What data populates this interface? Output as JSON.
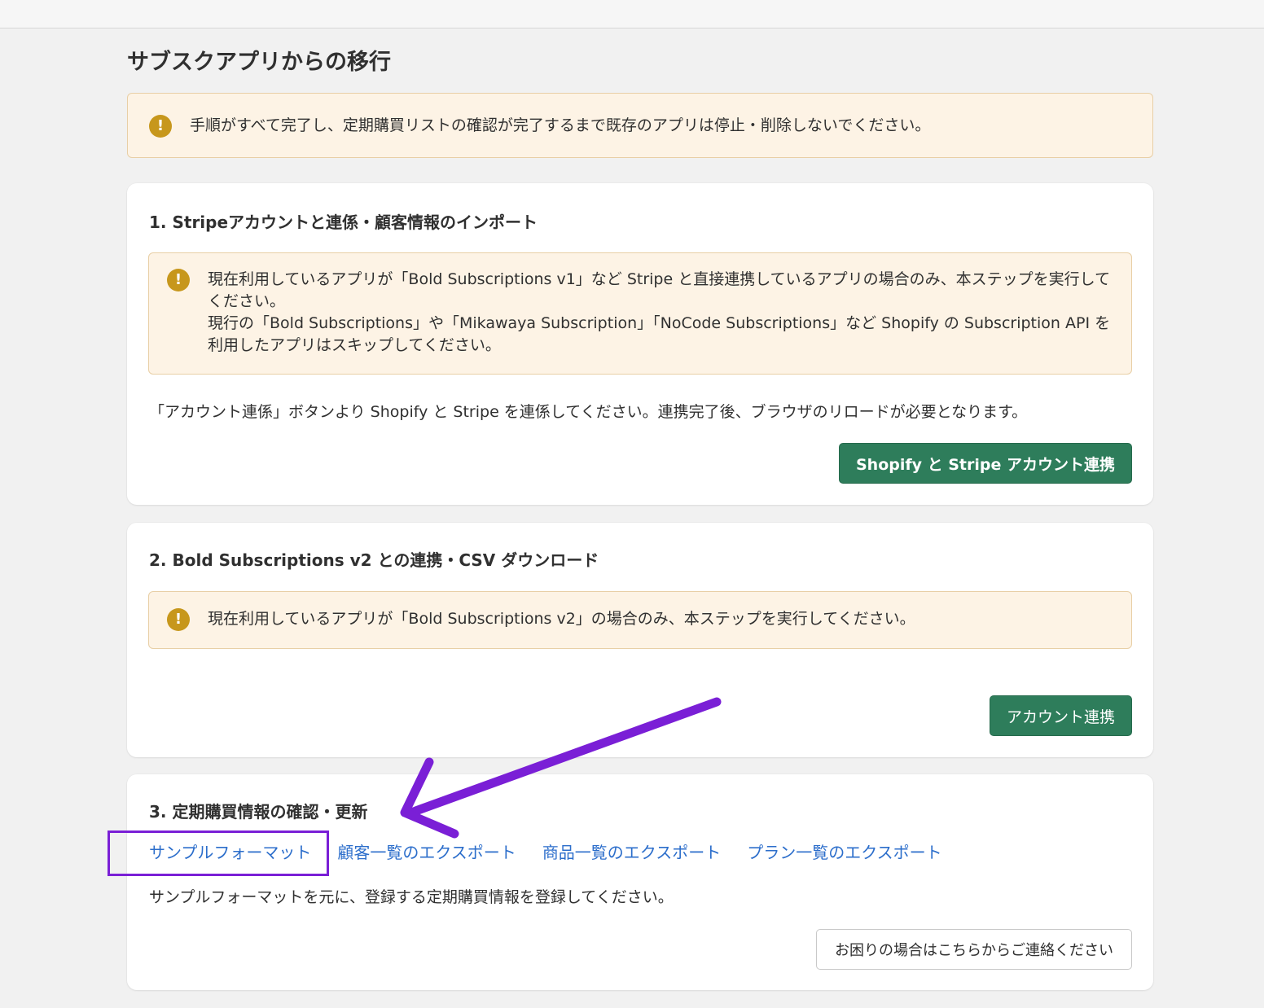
{
  "page": {
    "title": "サブスクアプリからの移行"
  },
  "top_warning": {
    "text": "手順がすべて完了し、定期購買リストの確認が完了するまで既存のアプリは停止・削除しないでください。"
  },
  "step1": {
    "title": "1. Stripeアカウントと連係・顧客情報のインポート",
    "warning_line1": "現在利用しているアプリが「Bold Subscriptions v1」など Stripe と直接連携しているアプリの場合のみ、本ステップを実行してください。",
    "warning_line2": "現行の「Bold Subscriptions」や「Mikawaya Subscription」「NoCode Subscriptions」など Shopify の Subscription API を利用したアプリはスキップしてください。",
    "description": "「アカウント連係」ボタンより Shopify と Stripe を連係してください。連携完了後、ブラウザのリロードが必要となります。",
    "button_label": "Shopify と Stripe アカウント連携"
  },
  "step2": {
    "title": "2. Bold Subscriptions v2 との連携・CSV ダウンロード",
    "warning": "現在利用しているアプリが「Bold Subscriptions v2」の場合のみ、本ステップを実行してください。",
    "button_label": "アカウント連携"
  },
  "step3": {
    "title": "3. 定期購買情報の確認・更新",
    "links": [
      {
        "label": "サンプルフォーマット"
      },
      {
        "label": "顧客一覧のエクスポート"
      },
      {
        "label": "商品一覧のエクスポート"
      },
      {
        "label": "プラン一覧のエクスポート"
      }
    ],
    "description": "サンプルフォーマットを元に、登録する定期購買情報を登録してください。",
    "contact_button_label": "お困りの場合はこちらからご連絡ください"
  },
  "icons": {
    "warning": "exclamation-circle-icon"
  },
  "colors": {
    "primary_button": "#2e7d5b",
    "link": "#2c6ecb",
    "warning_icon": "#c7971c",
    "warning_bg": "#fdf3e5",
    "annotation": "#7a1fd6"
  }
}
